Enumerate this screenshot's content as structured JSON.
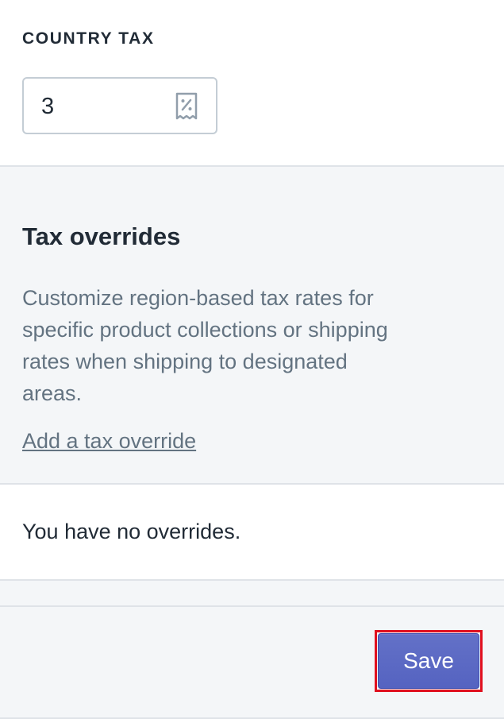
{
  "country_tax": {
    "label": "COUNTRY TAX",
    "value": "3",
    "icon": "receipt-percent-icon"
  },
  "overrides": {
    "title": "Tax overrides",
    "description": "Customize region-based tax rates for specific product collections or shipping rates when shipping to designated areas.",
    "add_link": "Add a tax override",
    "empty_message": "You have no overrides."
  },
  "footer": {
    "save_label": "Save"
  },
  "colors": {
    "primary_button": "#5c6ac4",
    "highlight_outline": "#e0101f",
    "subdued_text": "#637381"
  }
}
